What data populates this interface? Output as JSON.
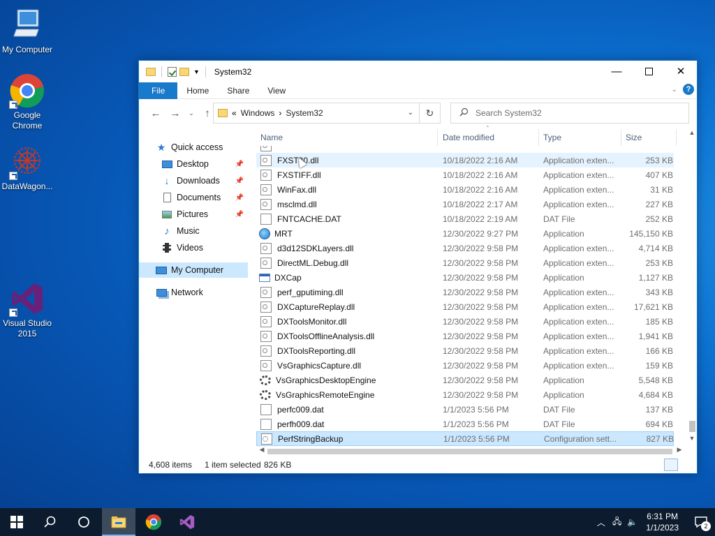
{
  "desktop": {
    "icons": [
      {
        "label": "My Computer"
      },
      {
        "label": "Google Chrome"
      },
      {
        "label": "DataWagon..."
      },
      {
        "label": "Visual Studio 2015"
      }
    ]
  },
  "window": {
    "title": "System32",
    "ribbon_tabs": [
      "File",
      "Home",
      "Share",
      "View"
    ],
    "address": {
      "prefix": "«",
      "crumbs": [
        "Windows",
        "System32"
      ]
    },
    "search_placeholder": "Search System32",
    "columns": {
      "name": "Name",
      "date": "Date modified",
      "type": "Type",
      "size": "Size"
    },
    "nav": {
      "quick_access": "Quick access",
      "items": [
        "Desktop",
        "Downloads",
        "Documents",
        "Pictures",
        "Music",
        "Videos"
      ],
      "my_computer": "My Computer",
      "network": "Network"
    },
    "files": [
      {
        "name": "",
        "date": "",
        "type": "",
        "size": "",
        "icon": "dll"
      },
      {
        "name": "FXST30.dll",
        "date": "10/18/2022 2:16 AM",
        "type": "Application exten...",
        "size": "253 KB",
        "icon": "dll"
      },
      {
        "name": "FXSTIFF.dll",
        "date": "10/18/2022 2:16 AM",
        "type": "Application exten...",
        "size": "407 KB",
        "icon": "dll"
      },
      {
        "name": "WinFax.dll",
        "date": "10/18/2022 2:16 AM",
        "type": "Application exten...",
        "size": "31 KB",
        "icon": "dll"
      },
      {
        "name": "msclmd.dll",
        "date": "10/18/2022 2:17 AM",
        "type": "Application exten...",
        "size": "227 KB",
        "icon": "dll"
      },
      {
        "name": "FNTCACHE.DAT",
        "date": "10/18/2022 2:19 AM",
        "type": "DAT File",
        "size": "252 KB",
        "icon": "dat"
      },
      {
        "name": "MRT",
        "date": "12/30/2022 9:27 PM",
        "type": "Application",
        "size": "145,150 KB",
        "icon": "mrt"
      },
      {
        "name": "d3d12SDKLayers.dll",
        "date": "12/30/2022 9:58 PM",
        "type": "Application exten...",
        "size": "4,714 KB",
        "icon": "dll"
      },
      {
        "name": "DirectML.Debug.dll",
        "date": "12/30/2022 9:58 PM",
        "type": "Application exten...",
        "size": "253 KB",
        "icon": "dll"
      },
      {
        "name": "DXCap",
        "date": "12/30/2022 9:58 PM",
        "type": "Application",
        "size": "1,127 KB",
        "icon": "app"
      },
      {
        "name": "perf_gputiming.dll",
        "date": "12/30/2022 9:58 PM",
        "type": "Application exten...",
        "size": "343 KB",
        "icon": "dll"
      },
      {
        "name": "DXCaptureReplay.dll",
        "date": "12/30/2022 9:58 PM",
        "type": "Application exten...",
        "size": "17,621 KB",
        "icon": "dll"
      },
      {
        "name": "DXToolsMonitor.dll",
        "date": "12/30/2022 9:58 PM",
        "type": "Application exten...",
        "size": "185 KB",
        "icon": "dll"
      },
      {
        "name": "DXToolsOfflineAnalysis.dll",
        "date": "12/30/2022 9:58 PM",
        "type": "Application exten...",
        "size": "1,941 KB",
        "icon": "dll"
      },
      {
        "name": "DXToolsReporting.dll",
        "date": "12/30/2022 9:58 PM",
        "type": "Application exten...",
        "size": "166 KB",
        "icon": "dll"
      },
      {
        "name": "VsGraphicsCapture.dll",
        "date": "12/30/2022 9:58 PM",
        "type": "Application exten...",
        "size": "159 KB",
        "icon": "dll"
      },
      {
        "name": "VsGraphicsDesktopEngine",
        "date": "12/30/2022 9:58 PM",
        "type": "Application",
        "size": "5,548 KB",
        "icon": "gear"
      },
      {
        "name": "VsGraphicsRemoteEngine",
        "date": "12/30/2022 9:58 PM",
        "type": "Application",
        "size": "4,684 KB",
        "icon": "gear"
      },
      {
        "name": "perfc009.dat",
        "date": "1/1/2023 5:56 PM",
        "type": "DAT File",
        "size": "137 KB",
        "icon": "dat"
      },
      {
        "name": "perfh009.dat",
        "date": "1/1/2023 5:56 PM",
        "type": "DAT File",
        "size": "694 KB",
        "icon": "dat"
      },
      {
        "name": "PerfStringBackup",
        "date": "1/1/2023 5:56 PM",
        "type": "Configuration sett...",
        "size": "827 KB",
        "icon": "cfg"
      }
    ],
    "status": {
      "items": "4,608 items",
      "selected": "1 item selected",
      "sel_size": "826 KB"
    }
  },
  "taskbar": {
    "time": "6:31 PM",
    "date": "1/1/2023",
    "notification_count": "2"
  },
  "colors": {
    "accent": "#1979ca",
    "selection": "#cce8ff",
    "taskbar": "#0d1b2e"
  }
}
